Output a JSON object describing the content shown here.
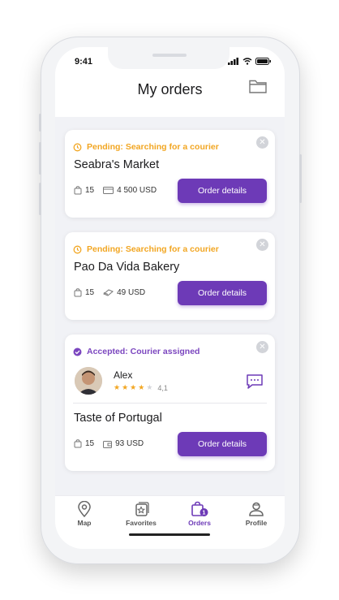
{
  "status_bar": {
    "time": "9:41"
  },
  "header": {
    "title": "My orders",
    "folder_icon": "folder-icon"
  },
  "colors": {
    "accent": "#6d3ab7",
    "pending": "#f2a622",
    "accepted": "#7b46bf"
  },
  "orders": [
    {
      "status": "Pending: Searching for a courier",
      "status_icon": "clock-icon",
      "store": "Seabra's Market",
      "items": "15",
      "amount": "4 500 USD",
      "payment_icon": "card-icon",
      "button": "Order details"
    },
    {
      "status": "Pending: Searching for a courier",
      "status_icon": "clock-icon",
      "store": "Pao Da Vida Bakery",
      "items": "15",
      "amount": "49 USD",
      "payment_icon": "cash-icon",
      "button": "Order details"
    },
    {
      "status": "Accepted: Courier assigned",
      "status_icon": "check-circle-icon",
      "courier": {
        "name": "Alex",
        "rating": "4,1",
        "stars": 4
      },
      "store": "Taste of Portugal",
      "items": "15",
      "amount": "93 USD",
      "payment_icon": "wallet-icon",
      "button": "Order details"
    }
  ],
  "tabs": [
    {
      "label": "Map",
      "icon": "map-pin-icon"
    },
    {
      "label": "Favorites",
      "icon": "favorites-icon"
    },
    {
      "label": "Orders",
      "icon": "orders-bag-icon",
      "badge": "1",
      "active": true
    },
    {
      "label": "Profile",
      "icon": "profile-icon"
    }
  ]
}
